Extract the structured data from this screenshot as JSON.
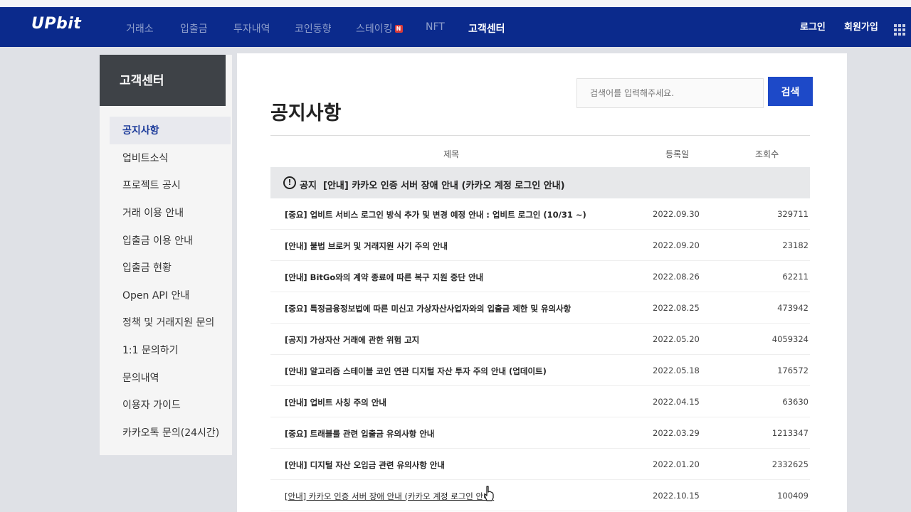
{
  "header": {
    "logo": "UPbit",
    "nav": [
      {
        "label": "거래소"
      },
      {
        "label": "입출금"
      },
      {
        "label": "투자내역"
      },
      {
        "label": "코인동향"
      },
      {
        "label": "스테이킹",
        "badge": "N"
      },
      {
        "label": "NFT"
      },
      {
        "label": "고객센터"
      }
    ],
    "login": "로그인",
    "signup": "회원가입"
  },
  "sidebar": {
    "title": "고객센터",
    "items": [
      {
        "label": "공지사항"
      },
      {
        "label": "업비트소식"
      },
      {
        "label": "프로젝트 공시"
      },
      {
        "label": "거래 이용 안내"
      },
      {
        "label": "입출금 이용 안내"
      },
      {
        "label": "입출금 현황"
      },
      {
        "label": "Open API 안내"
      },
      {
        "label": "정책 및 거래지원 문의"
      },
      {
        "label": "1:1 문의하기"
      },
      {
        "label": "문의내역"
      },
      {
        "label": "이용자 가이드"
      },
      {
        "label": "카카오톡 문의(24시간)"
      }
    ]
  },
  "main": {
    "title": "공지사항",
    "search": {
      "placeholder": "검색어를 입력해주세요.",
      "button": "검색"
    },
    "columns": {
      "title": "제목",
      "date": "등록일",
      "views": "조회수"
    },
    "pinned": {
      "label": "공지",
      "title": "[안내] 카카오 인증 서버 장애 안내 (카카오 계정 로그인 안내)"
    },
    "rows": [
      {
        "title": "[중요] 업비트 서비스 로그인 방식 추가 및 변경 예정 안내 : 업비트 로그인 (10/31 ~)",
        "date": "2022.09.30",
        "views": "329711"
      },
      {
        "title": "[안내] 불법 브로커 및 거래지원 사기 주의 안내",
        "date": "2022.09.20",
        "views": "23182"
      },
      {
        "title": "[안내] BitGo와의 계약 종료에 따른 복구 지원 중단 안내",
        "date": "2022.08.26",
        "views": "62211"
      },
      {
        "title": "[중요] 특정금융정보법에 따른 미신고 가상자산사업자와의 입출금 제한 및 유의사항",
        "date": "2022.08.25",
        "views": "473942"
      },
      {
        "title": "[공지] 가상자산 거래에 관한 위험 고지",
        "date": "2022.05.20",
        "views": "4059324"
      },
      {
        "title": "[안내] 알고리즘 스테이블 코인 연관 디지털 자산 투자 주의 안내 (업데이트)",
        "date": "2022.05.18",
        "views": "176572"
      },
      {
        "title": "[안내] 업비트 사칭 주의 안내",
        "date": "2022.04.15",
        "views": "63630"
      },
      {
        "title": "[중요] 트래블룰 관련 입출금 유의사항 안내",
        "date": "2022.03.29",
        "views": "1213347"
      },
      {
        "title": "[안내] 디지털 자산 오입금 관련 유의사항 안내",
        "date": "2022.01.20",
        "views": "2332625"
      },
      {
        "title": "[안내] 카카오 인증 서버 장애 안내 (카카오 계정 로그인 안내)",
        "date": "2022.10.15",
        "views": "100409"
      }
    ]
  },
  "colors": {
    "navbar": "#0b2a8c",
    "accent": "#1d49c8",
    "sidebar_head": "#3e4247"
  },
  "icons": {
    "notice": "exclamation-circle-icon",
    "apps": "grid-menu-icon",
    "cursor": "hand-pointer-icon"
  }
}
